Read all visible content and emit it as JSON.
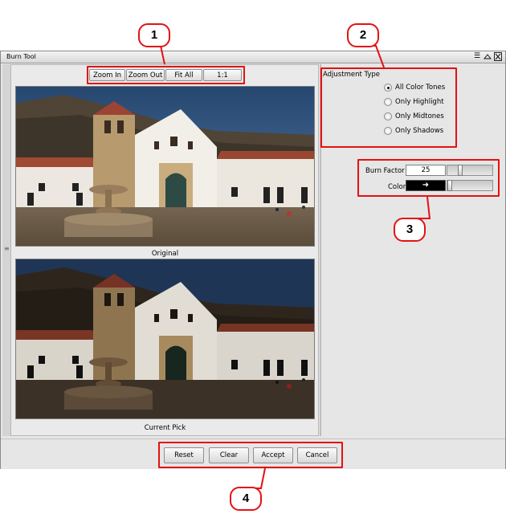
{
  "window": {
    "title": "Burn Tool"
  },
  "toolbar": {
    "zoom_in": "Zoom In",
    "zoom_out": "Zoom Out",
    "fit_all": "Fit All",
    "one_to_one": "1:1"
  },
  "captions": {
    "original": "Original",
    "current": "Current Pick"
  },
  "adjustment": {
    "title": "Adjustment Type",
    "options": [
      "All Color Tones",
      "Only Highlight",
      "Only Midtones",
      "Only Shadows"
    ],
    "selected": "All Color Tones"
  },
  "burn": {
    "factor_label": "Burn Factor",
    "factor_value": "25",
    "color_label": "Color",
    "color_swatch": "➜"
  },
  "buttons": {
    "reset": "Reset",
    "clear": "Clear",
    "accept": "Accept",
    "cancel": "Cancel"
  },
  "callouts": [
    "1",
    "2",
    "3",
    "4"
  ],
  "colors": {
    "highlight": "#e31212",
    "window_bg": "#e6e6e6"
  },
  "icons": {
    "menu": "hamburger-icon",
    "maximize": "triangle-up-icon",
    "close": "close-icon",
    "grip": "grip-icon"
  }
}
